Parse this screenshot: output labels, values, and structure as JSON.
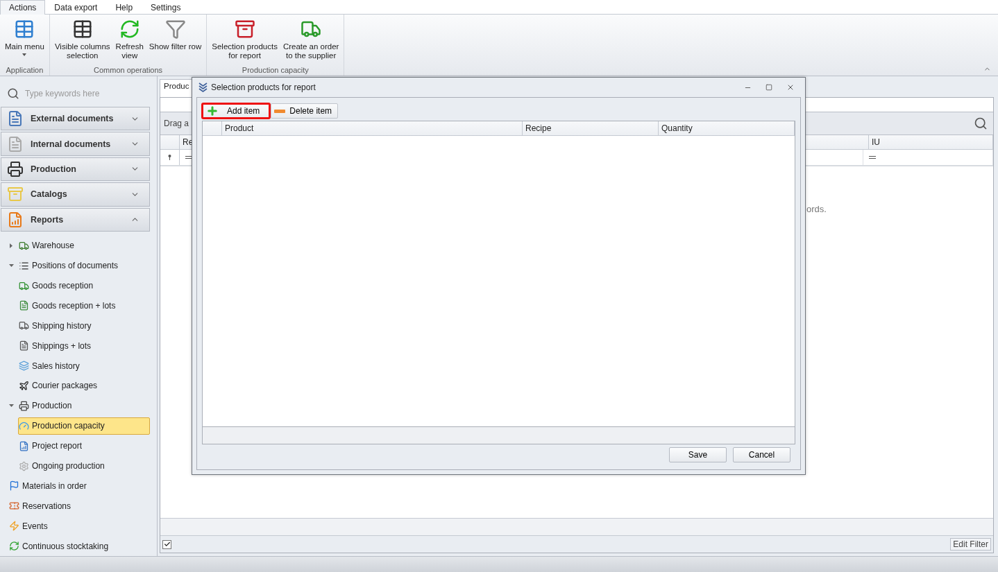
{
  "ribbon": {
    "tabs": [
      {
        "label": "Actions",
        "selected": true
      },
      {
        "label": "Data export",
        "selected": false
      },
      {
        "label": "Help",
        "selected": false
      },
      {
        "label": "Settings",
        "selected": false
      }
    ],
    "groups": [
      {
        "label": "Application",
        "buttons": [
          {
            "label": "Main menu",
            "dropdown": true
          }
        ]
      },
      {
        "label": "Common operations",
        "buttons": [
          {
            "label": "Visible columns\nselection",
            "dropdown": false
          },
          {
            "label": "Refresh\nview",
            "dropdown": false
          },
          {
            "label": "Show filter row",
            "dropdown": false
          }
        ]
      },
      {
        "label": "Production capacity",
        "buttons": [
          {
            "label": "Selection products\nfor report",
            "dropdown": false
          },
          {
            "label": "Create an order\nto the supplier",
            "dropdown": false
          }
        ]
      }
    ]
  },
  "sidebar": {
    "search": {
      "placeholder": "Type keywords here"
    },
    "groups": [
      {
        "label": "External documents",
        "expanded": false
      },
      {
        "label": "Internal documents",
        "expanded": false
      },
      {
        "label": "Production",
        "expanded": false
      },
      {
        "label": "Catalogs",
        "expanded": false
      },
      {
        "label": "Reports",
        "expanded": true
      }
    ],
    "tree": [
      {
        "label": "Warehouse",
        "expanded": false,
        "selected": false
      },
      {
        "label": "Positions of documents",
        "expanded": true,
        "selected": false,
        "children": [
          {
            "label": "Goods reception",
            "selected": false
          },
          {
            "label": "Goods reception + lots",
            "selected": false
          },
          {
            "label": "Shipping history",
            "selected": false
          },
          {
            "label": "Shippings + lots",
            "selected": false
          },
          {
            "label": "Sales history",
            "selected": false
          },
          {
            "label": "Courier packages",
            "selected": false
          }
        ]
      },
      {
        "label": "Production",
        "expanded": true,
        "selected": false,
        "children": [
          {
            "label": "Production capacity",
            "selected": true
          },
          {
            "label": "Project report",
            "selected": false
          },
          {
            "label": "Ongoing production",
            "selected": false
          }
        ]
      },
      {
        "label": "Materials in order",
        "selected": false
      },
      {
        "label": "Reservations",
        "selected": false
      },
      {
        "label": "Events",
        "selected": false
      },
      {
        "label": "Continuous stocktaking",
        "selected": false
      }
    ]
  },
  "main": {
    "tab": {
      "label": "Produc",
      "selected": true
    },
    "group_panel": "Drag a",
    "columns": [
      "Re",
      "IU"
    ],
    "empty_text": "ords.",
    "footer": {
      "filter_enabled": true,
      "edit_filter": "Edit Filter"
    }
  },
  "dialog": {
    "title": "Selection products for report",
    "toolbar": [
      {
        "label": "Add item",
        "kind": "add",
        "highlighted": true
      },
      {
        "label": "Delete item",
        "kind": "delete",
        "highlighted": false
      }
    ],
    "columns": [
      "Product",
      "Recipe",
      "Quantity"
    ],
    "buttons": [
      "Save",
      "Cancel"
    ]
  }
}
